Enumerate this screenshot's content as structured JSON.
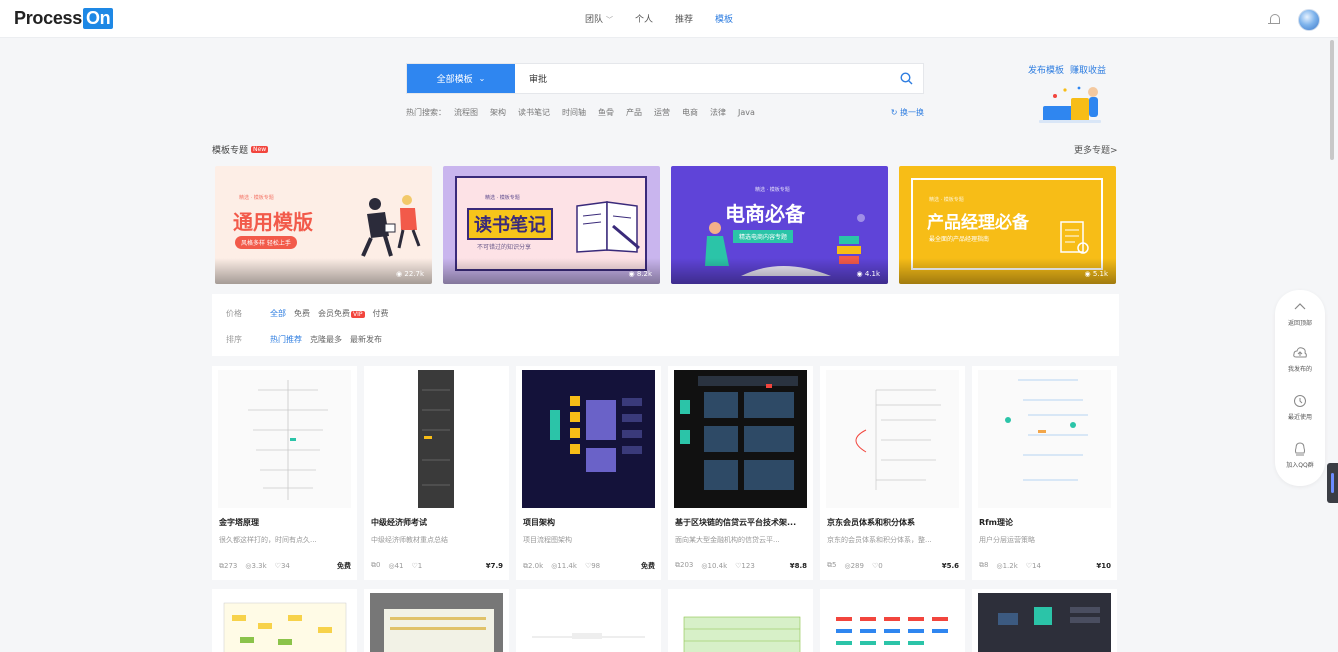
{
  "app": {
    "logo_text": "Process",
    "logo_badge": "On"
  },
  "nav": {
    "items": [
      {
        "label": "团队",
        "has_caret": true
      },
      {
        "label": "个人"
      },
      {
        "label": "推荐"
      },
      {
        "label": "模板",
        "active": true
      }
    ]
  },
  "search": {
    "type_label": "全部模板",
    "value": "审批",
    "hot_label": "热门搜索：",
    "hot_keywords": [
      "流程图",
      "架构",
      "读书笔记",
      "时间轴",
      "鱼骨",
      "产品",
      "运营",
      "电商",
      "法律",
      "Java"
    ],
    "refresh_label": "换一换"
  },
  "promo": {
    "publish_label": "发布模板",
    "earn_label": "赚取收益"
  },
  "section": {
    "title": "模板专题",
    "badge": "New",
    "more_label": "更多专题>"
  },
  "banners": [
    {
      "small": "精选 · 模板专题",
      "title": "通用模版",
      "button": "风格多样 轻松上手",
      "count": "22.7k",
      "color": "#fdeee6",
      "title_color": "#f25a4a"
    },
    {
      "small": "精选 · 模板专题",
      "title": "读书笔记",
      "sub": "不可错过的知识分享",
      "count": "8.2k",
      "color": "#c9b5ee",
      "title_color": "#3a2a7a"
    },
    {
      "small": "精选 · 模板专题",
      "title": "电商必备",
      "sub": "精选电商内容专题",
      "count": "4.1k",
      "color": "#5f44d8",
      "title_color": "#ffffff"
    },
    {
      "small": "精选 · 模板专题",
      "title": "产品经理必备",
      "sub": "最全面的产品经理指南",
      "count": "5.1k",
      "color": "#f7bd17",
      "title_color": "#ffffff"
    }
  ],
  "filters": {
    "price": {
      "label": "价格",
      "options": [
        "全部",
        "免费",
        "会员免费",
        "付费"
      ],
      "selected": "全部",
      "badge": "VIP"
    },
    "sort": {
      "label": "排序",
      "options": [
        "热门推荐",
        "克隆最多",
        "最新发布"
      ],
      "selected": "热门推荐"
    }
  },
  "cards": [
    {
      "title": "金字塔原理",
      "desc": "很久都这样打的，时间有点久...",
      "icon_count": "273",
      "views": "3.3k",
      "likes": "34",
      "price": "免费"
    },
    {
      "title": "中级经济师考试",
      "desc": "中级经济师教材重点总结",
      "icon_count": "0",
      "views": "41",
      "likes": "1",
      "price": "¥7.9"
    },
    {
      "title": "项目架构",
      "desc": "项目流程图架构",
      "icon_count": "2.0k",
      "views": "11.4k",
      "likes": "98",
      "price": "免费"
    },
    {
      "title": "基于区块链的信贷云平台技术架...",
      "desc": "面向某大型金融机构的信贷云平...",
      "icon_count": "203",
      "views": "10.4k",
      "likes": "123",
      "price": "¥8.8"
    },
    {
      "title": "京东会员体系和积分体系",
      "desc": "京东的会员体系和积分体系，整...",
      "icon_count": "5",
      "views": "289",
      "likes": "0",
      "price": "¥5.6"
    },
    {
      "title": "Rfm理论",
      "desc": "用户分层运营策略",
      "icon_count": "8",
      "views": "1.2k",
      "likes": "14",
      "price": "¥10"
    }
  ],
  "side_tools": [
    {
      "label": "返回顶部",
      "icon": "chevron-up-icon"
    },
    {
      "label": "我发布的",
      "icon": "cloud-upload-icon"
    },
    {
      "label": "最近使用",
      "icon": "clock-icon"
    },
    {
      "label": "加入QQ群",
      "icon": "qq-icon"
    }
  ],
  "colors": {
    "primary": "#2f86f0",
    "accent_red": "#f2453d",
    "background": "#f5f6f8"
  }
}
